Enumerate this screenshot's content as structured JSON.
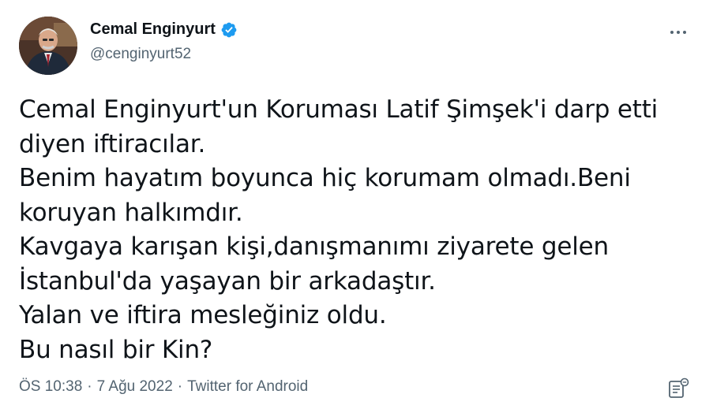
{
  "author": {
    "display_name": "Cemal Enginyurt",
    "handle": "@cenginyurt52",
    "verified_icon": "verified-badge-icon",
    "accent_color": "#1d9bf0"
  },
  "tweet": {
    "lines": [
      "Cemal Enginyurt'un Koruması Latif Şimşek'i darp etti",
      "diyen iftiracılar.",
      "Benim hayatım boyunca hiç korumam olmadı.Beni",
      "koruyan halkımdır.",
      "Kavgaya karışan kişi,danışmanımı ziyarete gelen",
      "İstanbul'da yaşayan bir arkadaştır.",
      "Yalan ve iftira mesleğiniz oldu.",
      "Bu nasıl bir Kin?"
    ]
  },
  "meta": {
    "time": "ÖS 10:38",
    "separator": "·",
    "date": "7 Ağu 2022",
    "source": "Twitter for Android"
  },
  "icons": {
    "more": "more-options-icon",
    "analytics": "tweet-analytics-icon"
  }
}
